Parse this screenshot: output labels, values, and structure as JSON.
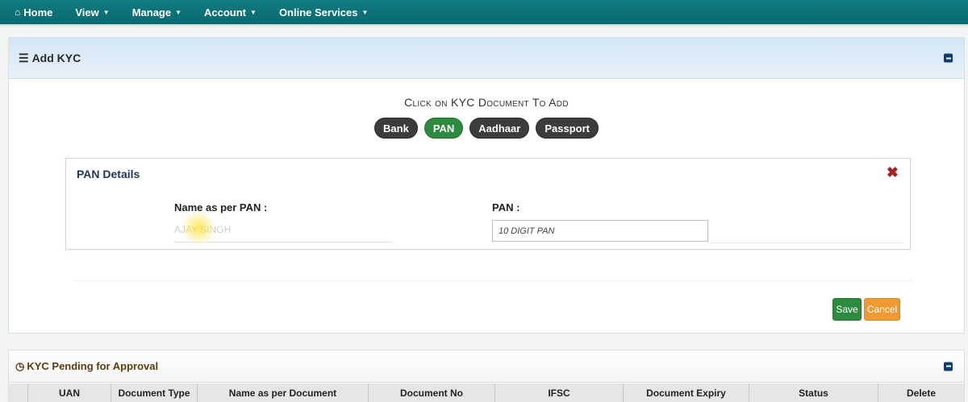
{
  "nav": {
    "home": "Home",
    "view": "View",
    "manage": "Manage",
    "account": "Account",
    "online_services": "Online Services"
  },
  "add_kyc": {
    "title": "Add KYC",
    "doc_heading": "Click on KYC Document To Add",
    "doc_buttons": [
      "Bank",
      "PAN",
      "Aadhaar",
      "Passport"
    ],
    "active_doc": "PAN"
  },
  "pan_details": {
    "title": "PAN Details",
    "name_label": "Name as per PAN  :",
    "name_value": "AJAY SINGH",
    "pan_label": "PAN  :",
    "pan_placeholder": "10 DIGIT PAN"
  },
  "actions": {
    "save": "Save",
    "cancel": "Cancel"
  },
  "pending": {
    "title": "KYC Pending for Approval",
    "columns": [
      "UAN",
      "Document Type",
      "Name as per Document",
      "Document No",
      "IFSC",
      "Document Expiry",
      "Status",
      "Delete"
    ]
  },
  "colors": {
    "nav_bg": "#0f7a80",
    "active_green": "#2e8a3e",
    "cancel_orange": "#ef9a33",
    "close_red": "#a8211c"
  }
}
